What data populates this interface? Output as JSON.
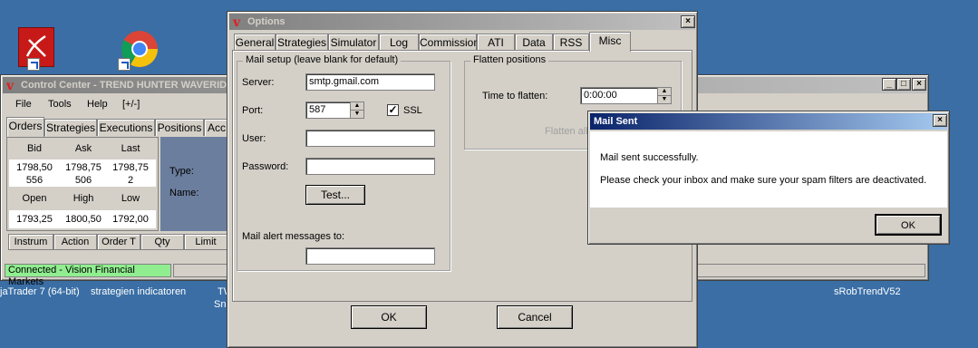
{
  "desktop": {
    "icons": [
      {
        "name": "pdf-reader-icon"
      },
      {
        "name": "chrome-icon"
      }
    ],
    "labels": {
      "ninja": "jaTrader 7 (64-bit)",
      "strategien": "strategien indicatoren",
      "tw": "TW",
      "sne": "Sne",
      "srob": "sRobTrendV52"
    }
  },
  "control_center": {
    "title": "Control Center - TREND HUNTER WAVERID",
    "menu": [
      "File",
      "Tools",
      "Help",
      "[+/-]"
    ],
    "tabs": [
      "Orders",
      "Strategies",
      "Executions",
      "Positions",
      "Acc"
    ],
    "quote_headers_1": [
      "Bid",
      "Ask",
      "Last"
    ],
    "quote_row_1": [
      "1798,50",
      "1798,75",
      "1798,75"
    ],
    "quote_row_2": [
      "556",
      "506",
      "2"
    ],
    "quote_headers_2": [
      "Open",
      "High",
      "Low"
    ],
    "quote_row_3": [
      "1793,25",
      "1800,50",
      "1792,00"
    ],
    "detail_labels": [
      "Type:",
      "Name:"
    ],
    "order_columns": [
      "Instrum",
      "Action",
      "Order T",
      "Qty",
      "Limit"
    ],
    "status": "Connected - Vision Financial Markets"
  },
  "options": {
    "title": "Options",
    "tabs": [
      "General",
      "Strategies",
      "Simulator",
      "Log",
      "Commission",
      "ATI",
      "Data",
      "RSS",
      "Misc"
    ],
    "selected_tab": "Misc",
    "mail_group": "Mail setup (leave blank for default)",
    "server_label": "Server:",
    "server_value": "smtp.gmail.com",
    "port_label": "Port:",
    "port_value": "587",
    "ssl_label": "SSL",
    "user_label": "User:",
    "password_label": "Password:",
    "test_button": "Test...",
    "alert_label": "Mail alert messages to:",
    "flatten_group": "Flatten positions",
    "flatten_label": "Time to flatten:",
    "flatten_value": "0:00:00",
    "flatten_button": "Flatten all",
    "ok_button": "OK",
    "cancel_button": "Cancel"
  },
  "mail_dialog": {
    "title": "Mail Sent",
    "line1": "Mail sent successfully.",
    "line2": "Please check your inbox and make sure your spam filters are deactivated.",
    "ok_button": "OK"
  }
}
